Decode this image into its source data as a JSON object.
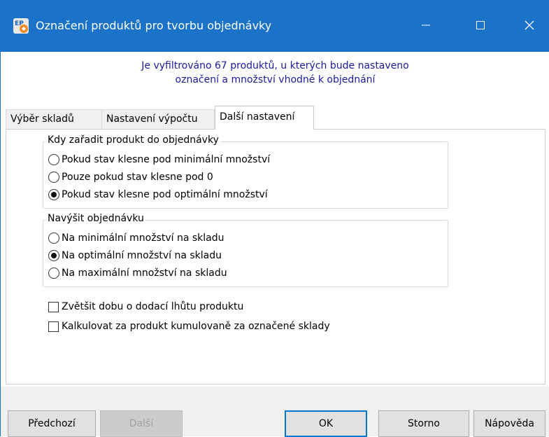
{
  "window": {
    "title": "Označení produktů pro tvorbu objednávky",
    "app_icon_text": "EP",
    "controls": {
      "minimize": "—",
      "maximize": "☐",
      "close": "✕"
    }
  },
  "info": {
    "line1": "Je vyfiltrováno 67 produktů, u kterých bude nastaveno",
    "line2": "označení a množství vhodné k objednání"
  },
  "tabs": [
    {
      "label": "Výběr skladů",
      "active": false
    },
    {
      "label": "Nastavení výpočtu",
      "active": false
    },
    {
      "label": "Další nastavení",
      "active": true
    }
  ],
  "group_when": {
    "title": "Kdy zařadit produkt do objednávky",
    "options": [
      {
        "label": "Pokud stav klesne pod minimální množství",
        "checked": false
      },
      {
        "label": "Pouze pokud stav klesne pod 0",
        "checked": false
      },
      {
        "label": "Pokud stav klesne pod optimální množství",
        "checked": true
      }
    ]
  },
  "group_raise": {
    "title": "Navýšit objednávku",
    "options": [
      {
        "label": "Na minimální množství na skladu",
        "checked": false
      },
      {
        "label": "Na optimální množství na skladu",
        "checked": true
      },
      {
        "label": "Na maximální množství na skladu",
        "checked": false
      }
    ]
  },
  "checkboxes": [
    {
      "label": "Zvětšit dobu o dodací lhůtu produktu",
      "checked": false
    },
    {
      "label": "Kalkulovat za produkt kumulovaně za označené sklady",
      "checked": false
    }
  ],
  "buttons": {
    "prev": "Předchozí",
    "next": "Další",
    "ok": "OK",
    "cancel": "Storno",
    "help": "Nápověda"
  },
  "colors": {
    "titlebar": "#1a73c9",
    "info_text": "#1a1aa0",
    "default_button_border": "#0078d7"
  }
}
